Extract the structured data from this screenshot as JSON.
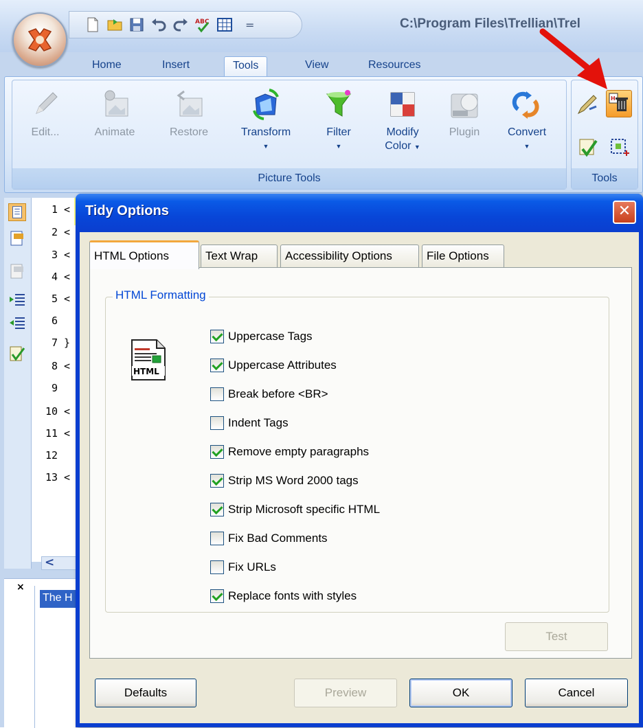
{
  "window": {
    "title_path": "C:\\Program Files\\Trellian\\Trel"
  },
  "quick_access": {
    "icons": [
      "new-file-icon",
      "open-folder-icon",
      "save-icon",
      "undo-icon",
      "redo-icon",
      "spellcheck-icon",
      "table-icon",
      "customize-dropdown-icon"
    ],
    "dropdown_glyph": "="
  },
  "tabs": [
    {
      "label": "Home"
    },
    {
      "label": "Insert"
    },
    {
      "label": "Tools",
      "active": true
    },
    {
      "label": "View"
    },
    {
      "label": "Resources"
    }
  ],
  "ribbon": {
    "picture_tools": {
      "label": "Picture Tools",
      "buttons": [
        {
          "label": "Edit...",
          "icon": "pencil-icon",
          "enabled": false
        },
        {
          "label": "Animate",
          "icon": "film-icon",
          "enabled": false
        },
        {
          "label": "Restore",
          "icon": "restore-image-icon",
          "enabled": false
        },
        {
          "label": "Transform",
          "icon": "transform-icon",
          "enabled": true
        },
        {
          "label": "Filter",
          "icon": "funnel-icon",
          "enabled": true
        },
        {
          "label": "Modify",
          "label2": "Color",
          "icon": "color-squares-icon",
          "enabled": true
        },
        {
          "label": "Plugin",
          "icon": "plugin-icon",
          "enabled": false
        },
        {
          "label": "Convert",
          "icon": "convert-icon",
          "enabled": true
        }
      ]
    },
    "tools": {
      "label": "Tools"
    }
  },
  "editor": {
    "line_numbers": [
      "1",
      "2",
      "3",
      "4",
      "5",
      "6",
      "7",
      "8",
      "9",
      "10",
      "11",
      "12",
      "13"
    ],
    "line_marks": [
      "<",
      "<",
      "<",
      "<",
      "<",
      "",
      "}",
      "<",
      "",
      "<",
      "<",
      "",
      "<"
    ],
    "bottom_panel_item": "The H",
    "bottom_close": "×",
    "scroll_left": "<"
  },
  "dialog": {
    "title": "Tidy Options",
    "close_glyph": "✕",
    "tabs": [
      {
        "label": "HTML Options",
        "active": true
      },
      {
        "label": "Text Wrap"
      },
      {
        "label": "Accessibility Options"
      },
      {
        "label": "File Options"
      }
    ],
    "group_title": "HTML Formatting",
    "icon_label": "HTML",
    "options": [
      {
        "label": "Uppercase Tags",
        "checked": true
      },
      {
        "label": "Uppercase Attributes",
        "checked": true
      },
      {
        "label": "Break before <BR>",
        "checked": false
      },
      {
        "label": "Indent Tags",
        "checked": false
      },
      {
        "label": "Remove empty paragraphs",
        "checked": true
      },
      {
        "label": "Strip MS Word 2000 tags",
        "checked": true
      },
      {
        "label": "Strip Microsoft specific HTML",
        "checked": true
      },
      {
        "label": "Fix Bad Comments",
        "checked": false
      },
      {
        "label": "Fix URLs",
        "checked": false
      },
      {
        "label": "Replace fonts with styles",
        "checked": true
      }
    ],
    "test_label": "Test",
    "buttons": {
      "defaults": "Defaults",
      "preview": "Preview",
      "ok": "OK",
      "cancel": "Cancel"
    }
  },
  "colors": {
    "dialog_title_blue": "#0a3ecf",
    "ribbon_text": "#15428b",
    "checkmark_green": "#21a121",
    "active_tab_accent": "#f2a73d",
    "arrow_red": "#e3120b"
  }
}
